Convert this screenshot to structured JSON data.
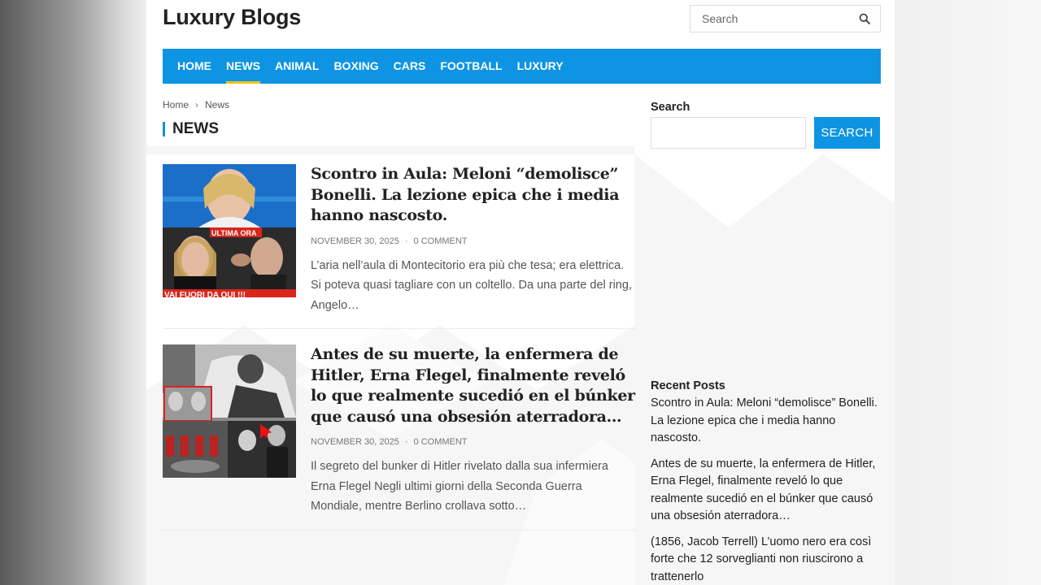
{
  "site": {
    "title": "Luxury Blogs"
  },
  "header_search": {
    "placeholder": "Search",
    "icon": "search-icon"
  },
  "nav": {
    "items": [
      {
        "label": "HOME",
        "active": false
      },
      {
        "label": "NEWS",
        "active": true
      },
      {
        "label": "ANIMAL",
        "active": false
      },
      {
        "label": "BOXING",
        "active": false
      },
      {
        "label": "CARS",
        "active": false
      },
      {
        "label": "FOOTBALL",
        "active": false
      },
      {
        "label": "LUXURY",
        "active": false
      }
    ],
    "color": "#0e94e3",
    "active_underline": "#f5c518"
  },
  "breadcrumb": {
    "home": "Home",
    "current": "News"
  },
  "category": {
    "title": "NEWS"
  },
  "posts": [
    {
      "title": "Scontro in Aula: Meloni “demolisce” Bonelli. La lezione epica che i media hanno nascosto.",
      "date": "NOVEMBER 30, 2025",
      "comments": "0 COMMENT",
      "excerpt": "L’aria nell’aula di Montecitorio era più che tesa; era elettrica. Si poteva quasi tagliare con un coltello. Da una parte del ring, Angelo…",
      "thumb_badge": "ULTIMA ORA",
      "thumb_caption": "VAI FUORI DA QUI !!!"
    },
    {
      "title": "Antes de su muerte, la enfermera de Hitler, Erna Flegel, finalmente reveló lo que realmente sucedió en el búnker que causó una obsesión aterradora…",
      "date": "NOVEMBER 30, 2025",
      "comments": "0 COMMENT",
      "excerpt": "Il segreto del bunker di Hitler rivelato dalla sua infermiera Erna Flegel Negli ultimi giorni della Seconda Guerra Mondiale, mentre Berlino crollava sotto…"
    }
  ],
  "sidebar": {
    "search_title": "Search",
    "search_button": "SEARCH",
    "recent_title": "Recent Posts",
    "recent_posts": [
      "Scontro in Aula: Meloni “demolisce” Bonelli. La lezione epica che i media hanno nascosto.",
      "Antes de su muerte, la enfermera de Hitler, Erna Flegel, finalmente reveló lo que realmente sucedió en el búnker que causó una obsesión aterradora…",
      "(1856, Jacob Terrell) L’uomo nero era così forte che 12 sorveglianti non riuscirono a trattenerlo"
    ]
  }
}
